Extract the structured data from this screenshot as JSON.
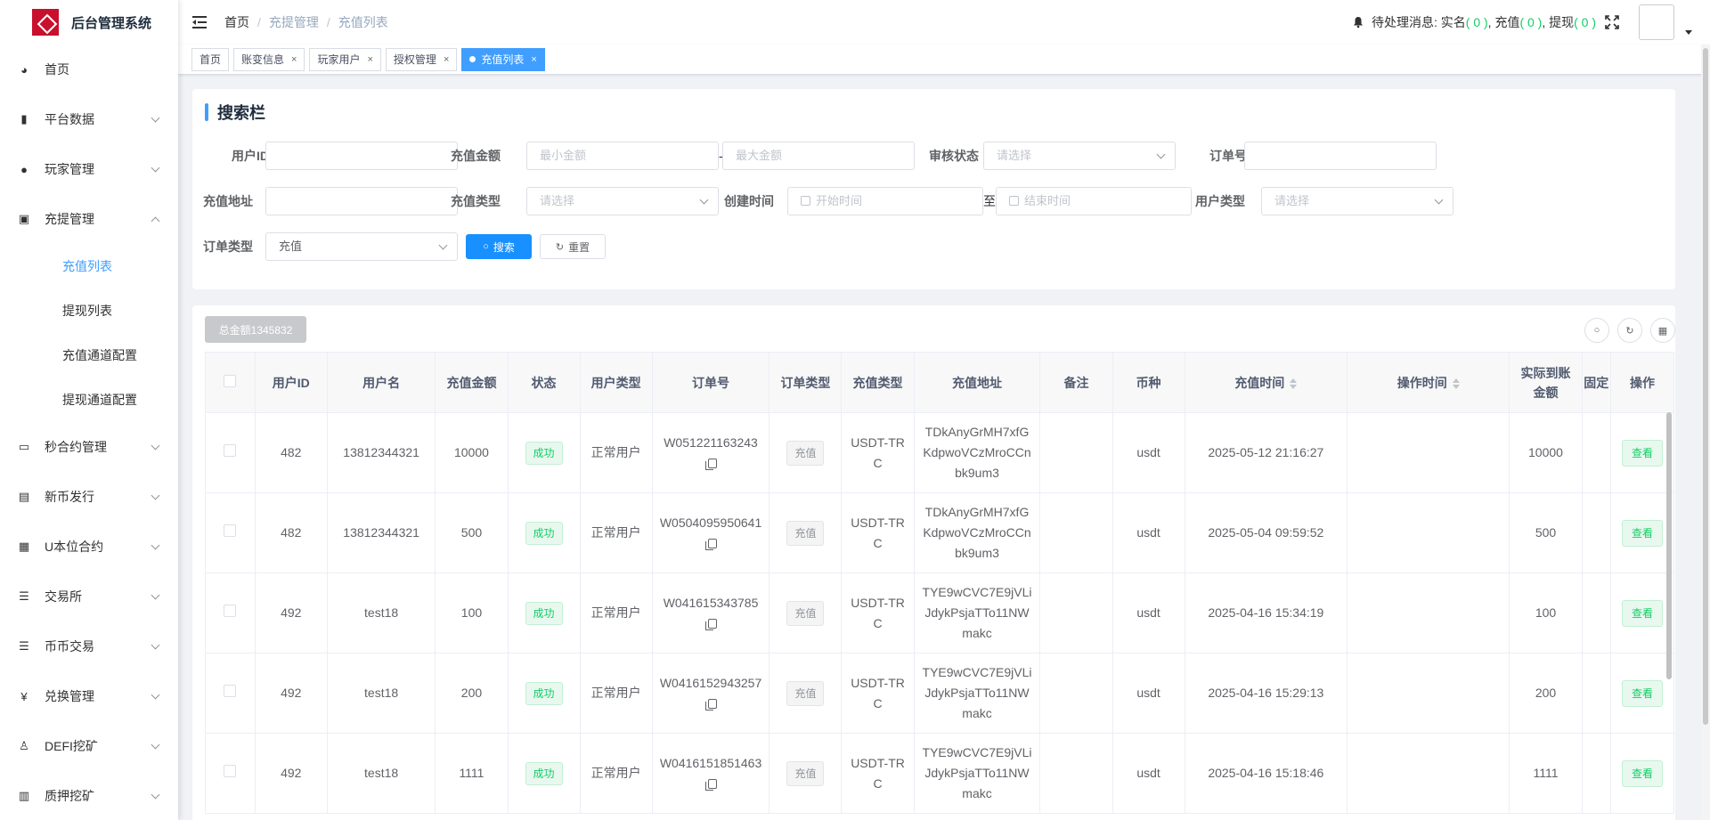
{
  "app": {
    "title": "后台管理系统"
  },
  "sidebar": {
    "items": [
      {
        "label": "首页",
        "icon": "dashboard-icon",
        "glyph": "◕",
        "expandable": false,
        "expanded": false
      },
      {
        "label": "平台数据",
        "icon": "book-icon",
        "glyph": "▮",
        "expandable": true,
        "expanded": false
      },
      {
        "label": "玩家管理",
        "icon": "user-icon",
        "glyph": "●",
        "expandable": true,
        "expanded": false
      },
      {
        "label": "充提管理",
        "icon": "documents-icon",
        "glyph": "▣",
        "expandable": true,
        "expanded": true,
        "children": [
          {
            "label": "充值列表",
            "active": true
          },
          {
            "label": "提现列表",
            "active": false
          },
          {
            "label": "充值通道配置",
            "active": false
          },
          {
            "label": "提现通道配置",
            "active": false
          }
        ]
      },
      {
        "label": "秒合约管理",
        "icon": "monitor-chart-icon",
        "glyph": "▭",
        "expandable": true,
        "expanded": false
      },
      {
        "label": "新币发行",
        "icon": "ticket-icon",
        "glyph": "▤",
        "expandable": true,
        "expanded": false
      },
      {
        "label": "U本位合约",
        "icon": "grid-table-icon",
        "glyph": "▦",
        "expandable": true,
        "expanded": false
      },
      {
        "label": "交易所",
        "icon": "list-icon",
        "glyph": "☰",
        "expandable": true,
        "expanded": false
      },
      {
        "label": "币币交易",
        "icon": "list-icon",
        "glyph": "☰",
        "expandable": true,
        "expanded": false
      },
      {
        "label": "兑换管理",
        "icon": "yen-icon",
        "glyph": "¥",
        "expandable": true,
        "expanded": false
      },
      {
        "label": "DEFI挖矿",
        "icon": "people-icon",
        "glyph": "♙",
        "expandable": true,
        "expanded": false
      },
      {
        "label": "质押挖矿",
        "icon": "bar-chart-icon",
        "glyph": "▥",
        "expandable": true,
        "expanded": false
      }
    ]
  },
  "navbar": {
    "breadcrumb": [
      "首页",
      "充提管理",
      "充值列表"
    ],
    "breadcrumb_sep": "/",
    "pending_label": "待处理消息:",
    "pending": [
      {
        "label": "实名",
        "count": "( 0 )",
        "tail": ","
      },
      {
        "label": "充值",
        "count": "( 0 )",
        "tail": ","
      },
      {
        "label": "提现",
        "count": "( 0 )",
        "tail": ""
      }
    ]
  },
  "tags": [
    {
      "label": "首页",
      "closable": false,
      "active": false
    },
    {
      "label": "账变信息",
      "closable": true,
      "active": false
    },
    {
      "label": "玩家用户",
      "closable": true,
      "active": false
    },
    {
      "label": "授权管理",
      "closable": true,
      "active": false
    },
    {
      "label": "充值列表",
      "closable": true,
      "active": true
    }
  ],
  "search": {
    "title": "搜索栏",
    "user_id_label": "用户ID",
    "amount_label": "充值金额",
    "amount_min_placeholder": "最小金额",
    "amount_sep": "-",
    "amount_max_placeholder": "最大金额",
    "audit_label": "审核状态",
    "audit_placeholder": "请选择",
    "order_no_label": "订单号",
    "address_label": "充值地址",
    "recharge_type_label": "充值类型",
    "recharge_type_placeholder": "请选择",
    "created_label": "创建时间",
    "start_placeholder": "开始时间",
    "date_sep": "至",
    "end_placeholder": "结束时间",
    "user_type_label": "用户类型",
    "user_type_placeholder": "请选择",
    "order_type_label": "订单类型",
    "order_type_value": "充值",
    "search_button": "搜索",
    "reset_button": "重置"
  },
  "table": {
    "total_button": "总金额1345832",
    "columns": [
      "用户ID",
      "用户名",
      "充值金额",
      "状态",
      "用户类型",
      "订单号",
      "订单类型",
      "充值类型",
      "充值地址",
      "备注",
      "币种",
      "充值时间",
      "操作时间",
      "实际到账金额",
      "固定",
      "操作"
    ],
    "rows": [
      {
        "user_id": "482",
        "username": "13812344321",
        "amount": "10000",
        "status": "成功",
        "user_type": "正常用户",
        "order_no": "W051221163243",
        "order_type": "充值",
        "recharge_type": "USDT-TRC",
        "address": "TDkAnyGrMH7xfGKdpwoVCzMroCCnbk9um3",
        "remark": "",
        "currency": "usdt",
        "recharge_time": "2025-05-12 21:16:27",
        "op_time": "",
        "actual_amount": "10000",
        "action": "查看"
      },
      {
        "user_id": "482",
        "username": "13812344321",
        "amount": "500",
        "status": "成功",
        "user_type": "正常用户",
        "order_no": "W0504095950641",
        "order_type": "充值",
        "recharge_type": "USDT-TRC",
        "address": "TDkAnyGrMH7xfGKdpwoVCzMroCCnbk9um3",
        "remark": "",
        "currency": "usdt",
        "recharge_time": "2025-05-04 09:59:52",
        "op_time": "",
        "actual_amount": "500",
        "action": "查看"
      },
      {
        "user_id": "492",
        "username": "test18",
        "amount": "100",
        "status": "成功",
        "user_type": "正常用户",
        "order_no": "W041615343785",
        "order_type": "充值",
        "recharge_type": "USDT-TRC",
        "address": "TYE9wCVC7E9jVLiJdykPsjaTTo11NWmakc",
        "remark": "",
        "currency": "usdt",
        "recharge_time": "2025-04-16 15:34:19",
        "op_time": "",
        "actual_amount": "100",
        "action": "查看"
      },
      {
        "user_id": "492",
        "username": "test18",
        "amount": "200",
        "status": "成功",
        "user_type": "正常用户",
        "order_no": "W0416152943257",
        "order_type": "充值",
        "recharge_type": "USDT-TRC",
        "address": "TYE9wCVC7E9jVLiJdykPsjaTTo11NWmakc",
        "remark": "",
        "currency": "usdt",
        "recharge_time": "2025-04-16 15:29:13",
        "op_time": "",
        "actual_amount": "200",
        "action": "查看"
      },
      {
        "user_id": "492",
        "username": "test18",
        "amount": "1111",
        "status": "成功",
        "user_type": "正常用户",
        "order_no": "W0416151851463",
        "order_type": "充值",
        "recharge_type": "USDT-TRC",
        "address": "TYE9wCVC7E9jVLiJdykPsjaTTo11NWmakc",
        "remark": "",
        "currency": "usdt",
        "recharge_time": "2025-04-16 15:18:46",
        "op_time": "",
        "actual_amount": "1111",
        "action": "查看"
      }
    ]
  },
  "colors": {
    "primary": "#1890ff",
    "success": "#13ce66",
    "logo": "#c8102e"
  }
}
